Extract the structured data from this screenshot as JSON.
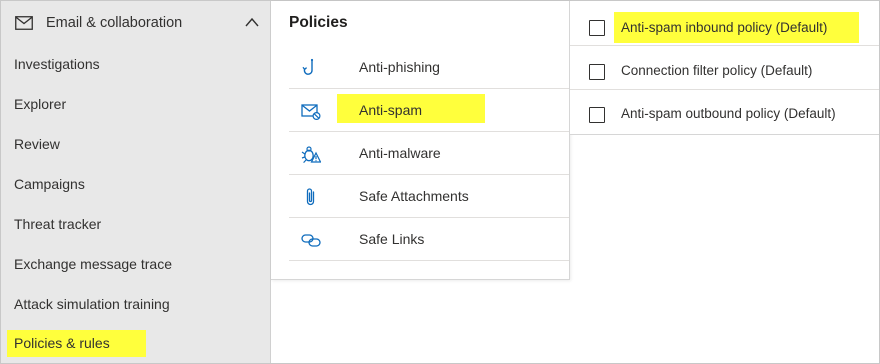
{
  "sidebar": {
    "section_label": "Email & collaboration",
    "items": [
      {
        "label": "Investigations"
      },
      {
        "label": "Explorer"
      },
      {
        "label": "Review"
      },
      {
        "label": "Campaigns"
      },
      {
        "label": "Threat tracker"
      },
      {
        "label": "Exchange message trace"
      },
      {
        "label": "Attack simulation training"
      },
      {
        "label": "Policies & rules",
        "highlighted": true
      }
    ]
  },
  "policies_menu": {
    "title": "Policies",
    "items": [
      {
        "label": "Anti-phishing",
        "icon": "fishhook-icon"
      },
      {
        "label": "Anti-spam",
        "icon": "mail-blocked-icon",
        "highlighted": true
      },
      {
        "label": "Anti-malware",
        "icon": "bug-icon"
      },
      {
        "label": "Safe Attachments",
        "icon": "paperclip-icon"
      },
      {
        "label": "Safe Links",
        "icon": "link-icon"
      }
    ]
  },
  "policy_list": {
    "rows": [
      {
        "label": "Anti-spam inbound policy (Default)",
        "checked": false,
        "highlighted": true
      },
      {
        "label": "Connection filter policy (Default)",
        "checked": false
      },
      {
        "label": "Anti-spam outbound policy (Default)",
        "checked": false
      }
    ]
  },
  "colors": {
    "highlight": "#ffff3c",
    "icon_blue": "#0f6cbd",
    "sidebar_bg": "#e8e8e8"
  }
}
